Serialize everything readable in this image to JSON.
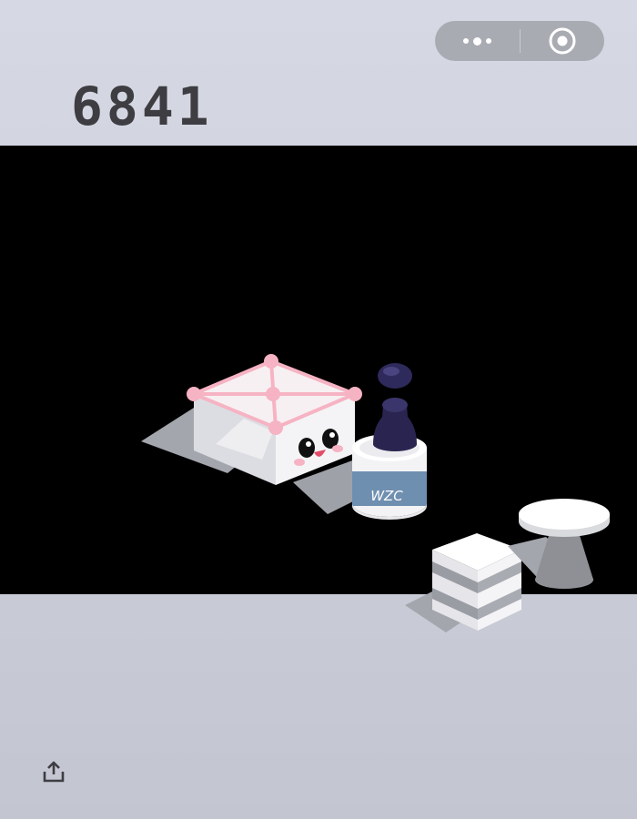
{
  "score": "6841",
  "capsule": {
    "more_icon": "more-dots-icon",
    "close_icon": "target-close-icon"
  },
  "bottle_label": "WZC",
  "share_icon": "share-upload-icon",
  "colors": {
    "background_top": "#d6d8e4",
    "background_bottom": "#c3c5d1",
    "playfield": "#000000",
    "score_text": "#3d3d42",
    "pink_accent": "#f6b3c3",
    "bottle_label": "#6f8fb0",
    "piece": "#2a2550"
  }
}
